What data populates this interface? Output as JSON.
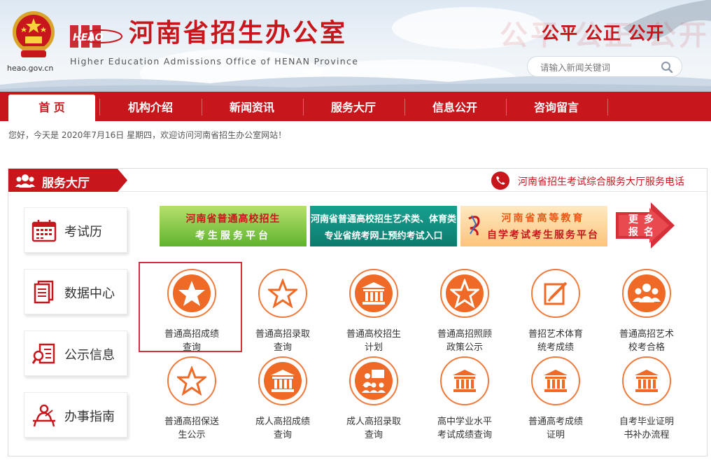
{
  "header": {
    "domain": "heao.gov.cn",
    "logo_text": "HEAO",
    "title": "河南省招生办公室",
    "subtitle": "Higher Education Admissions Office of HENAN Province",
    "slogan": "公平 公正 公开",
    "slogan_shadow": "公平 公正 公开",
    "search_placeholder": "请输入新闻关键词"
  },
  "nav": {
    "items": [
      {
        "label": "首 页",
        "active": true
      },
      {
        "label": "机构介绍"
      },
      {
        "label": "新闻资讯"
      },
      {
        "label": "服务大厅"
      },
      {
        "label": "信息公开"
      },
      {
        "label": "咨询留言"
      }
    ]
  },
  "welcome": "您好，今天是 2020年7月16日 星期四，欢迎访问河南省招生办公室网站！",
  "panel": {
    "title": "服务大厅",
    "hotline": "河南省招生考试综合服务大厅服务电话",
    "side": [
      {
        "label": "考试历",
        "icon": "calendar-icon"
      },
      {
        "label": "数据中心",
        "icon": "documents-icon"
      },
      {
        "label": "公示信息",
        "icon": "magnifier-document-icon"
      },
      {
        "label": "办事指南",
        "icon": "person-desk-icon"
      }
    ],
    "banners": [
      {
        "line1": "河南省普通高校招生",
        "line2": "考生服务平台"
      },
      {
        "line1": "河南省普通高校招生艺术类、体育类",
        "line2": "专业省统考网上预约考试入口"
      },
      {
        "line1": "河南省高等教育",
        "line2": "自学考试考生服务平台"
      }
    ],
    "more": {
      "c1": "更",
      "c2": "多",
      "c3": "报",
      "c4": "名"
    },
    "services": [
      {
        "line1": "普通高招成绩",
        "line2": "查询",
        "icon": "star-icon"
      },
      {
        "line1": "普通高招录取",
        "line2": "查询",
        "icon": "star-outline-icon"
      },
      {
        "line1": "普通高校招生",
        "line2": "计划",
        "icon": "building-icon"
      },
      {
        "line1": "普通高招照顾",
        "line2": "政策公示",
        "icon": "star-icon"
      },
      {
        "line1": "普招艺术体育",
        "line2": "统考成绩",
        "icon": "edit-icon"
      },
      {
        "line1": "普通高招艺术",
        "line2": "校考合格",
        "icon": "group-icon"
      },
      {
        "line1": "普通高招保送",
        "line2": "生公示",
        "icon": "star-outline-icon"
      },
      {
        "line1": "成人高招成绩",
        "line2": "查询",
        "icon": "building-icon"
      },
      {
        "line1": "成人高招录取",
        "line2": "查询",
        "icon": "presentation-icon"
      },
      {
        "line1": "高中学业水平",
        "line2": "考试成绩查询",
        "icon": "building-icon"
      },
      {
        "line1": "普通高考成绩",
        "line2": "证明",
        "icon": "building-icon"
      },
      {
        "line1": "自考毕业证明",
        "line2": "书补办流程",
        "icon": "building-icon"
      }
    ]
  },
  "colors": {
    "brand_red": "#c8161d",
    "accent_orange": "#ee6a26"
  }
}
